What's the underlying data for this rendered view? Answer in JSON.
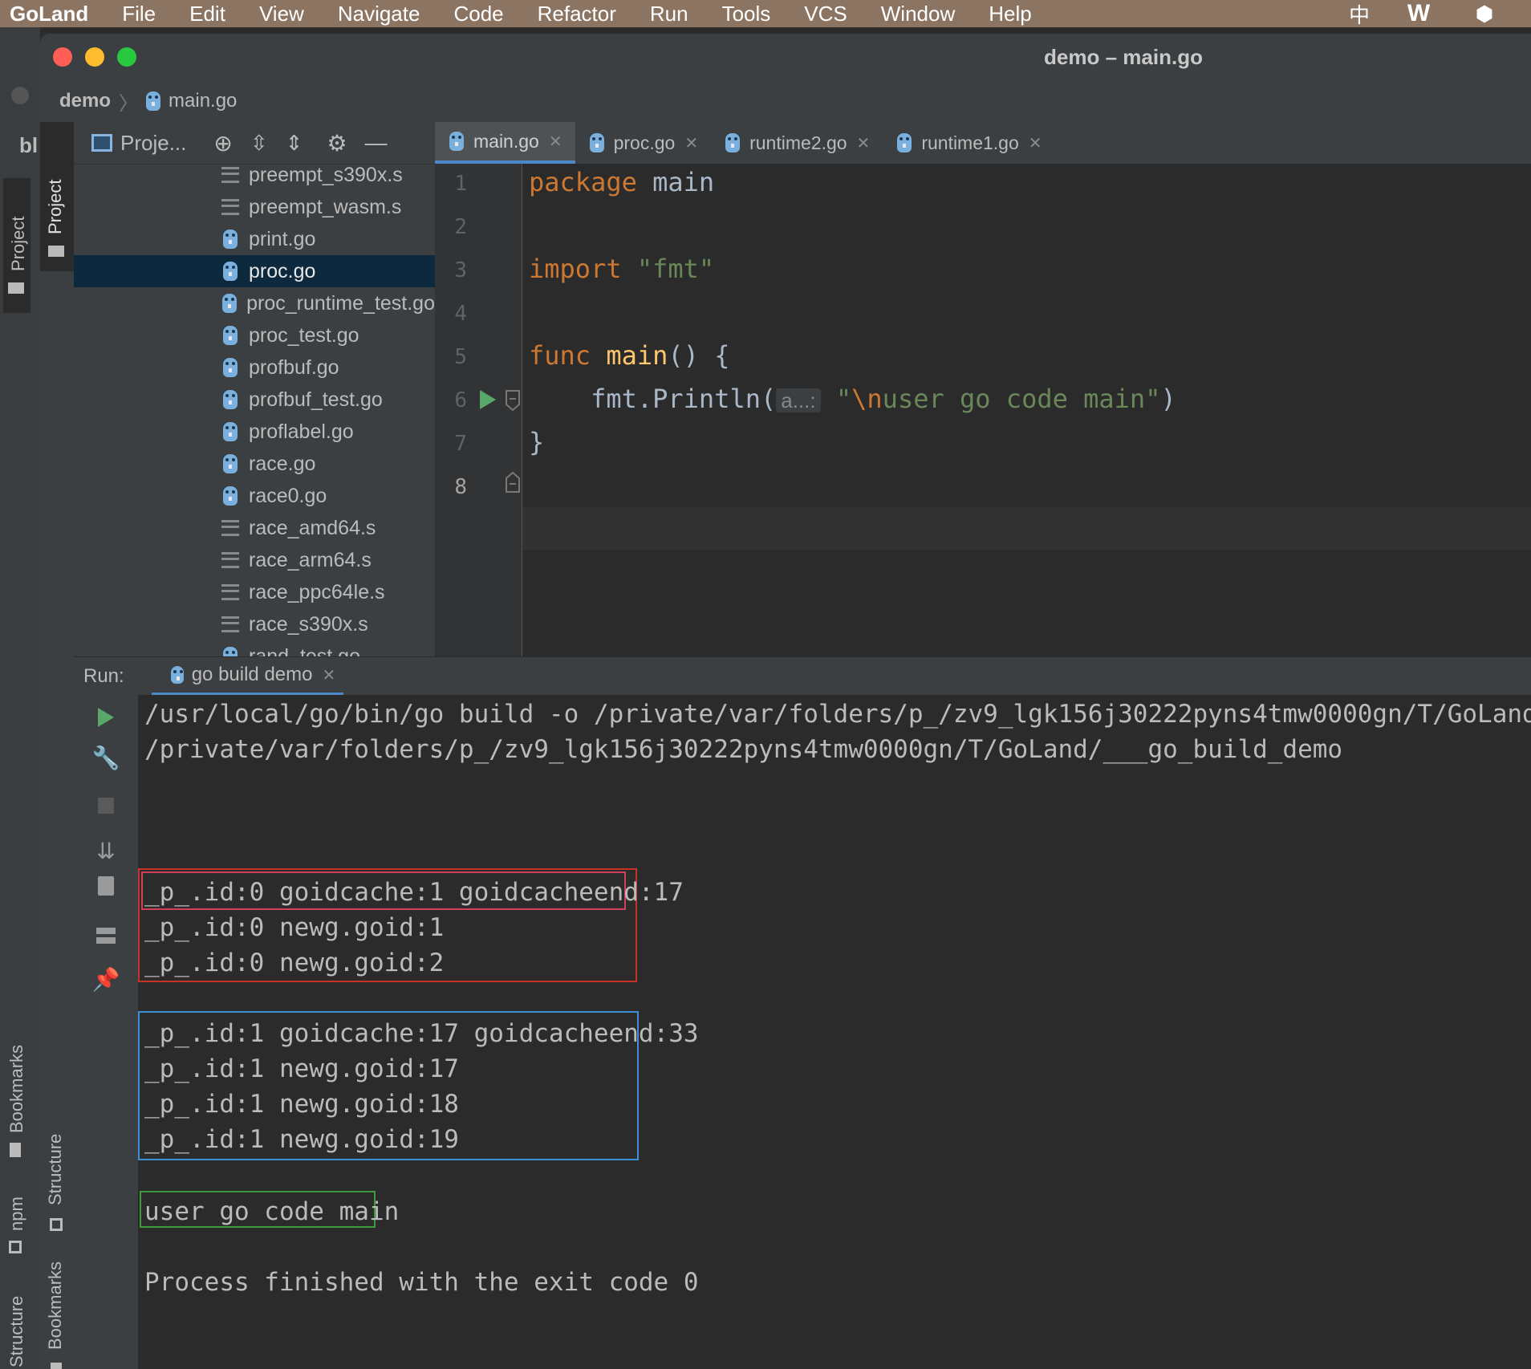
{
  "menubar": {
    "app": "GoLand",
    "items": [
      "File",
      "Edit",
      "View",
      "Navigate",
      "Code",
      "Refactor",
      "Run",
      "Tools",
      "VCS",
      "Window",
      "Help"
    ],
    "right_icons": [
      "input-method-icon",
      "w-app-icon",
      "hexagon-app-icon"
    ],
    "ime_glyph": "中",
    "w_glyph": "W",
    "hex_glyph": "⬢"
  },
  "bg_window": {
    "text": "bl",
    "tab": "Project"
  },
  "window": {
    "title": "demo – main.go",
    "breadcrumb": {
      "project": "demo",
      "file": "main.go"
    }
  },
  "tool_strip": {
    "project": "Project",
    "structure": "Structure",
    "bookmarks": "Bookmarks",
    "npm": "npm",
    "bookmarks_left": "Bookmarks",
    "structure_left": "Structure"
  },
  "project_panel": {
    "title": "Proje...",
    "icons": [
      "locate-icon",
      "expand-all-icon",
      "collapse-all-icon",
      "gear-icon",
      "minimize-icon"
    ],
    "files": [
      {
        "name": "preempt_s390x.s",
        "type": "asm"
      },
      {
        "name": "preempt_wasm.s",
        "type": "asm"
      },
      {
        "name": "print.go",
        "type": "go"
      },
      {
        "name": "proc.go",
        "type": "go",
        "selected": true
      },
      {
        "name": "proc_runtime_test.go",
        "type": "gotest"
      },
      {
        "name": "proc_test.go",
        "type": "gotest"
      },
      {
        "name": "profbuf.go",
        "type": "go"
      },
      {
        "name": "profbuf_test.go",
        "type": "gotest"
      },
      {
        "name": "proflabel.go",
        "type": "go"
      },
      {
        "name": "race.go",
        "type": "go"
      },
      {
        "name": "race0.go",
        "type": "go"
      },
      {
        "name": "race_amd64.s",
        "type": "asm"
      },
      {
        "name": "race_arm64.s",
        "type": "asm"
      },
      {
        "name": "race_ppc64le.s",
        "type": "asm"
      },
      {
        "name": "race_s390x.s",
        "type": "asm"
      },
      {
        "name": "rand_test.go",
        "type": "gotest"
      }
    ]
  },
  "editor": {
    "tabs": [
      {
        "label": "main.go",
        "active": true
      },
      {
        "label": "proc.go"
      },
      {
        "label": "runtime2.go"
      },
      {
        "label": "runtime1.go"
      }
    ],
    "line_numbers": [
      "1",
      "2",
      "3",
      "4",
      "5",
      "6",
      "7",
      "8"
    ],
    "code": {
      "l1_kw": "package",
      "l1_rest": " main",
      "l3_kw": "import",
      "l3_str": " \"fmt\"",
      "l5_kw": "func",
      "l5_fn": " main",
      "l5_rest": "() {",
      "l6_pre": "    fmt.Println(",
      "l6_hint": "a...:",
      "l6_q": "\"",
      "l6_esc": "\\n",
      "l6_str": "user go code main\"",
      "l6_end": ")",
      "l7": "}"
    }
  },
  "run": {
    "label": "Run:",
    "tab": "go build demo",
    "lines": {
      "cmd1": "/usr/local/go/bin/go build -o /private/var/folders/p_/zv9_lgk156j30222pyns4tmw0000gn/T/GoLand/___go_build_demo",
      "cmd2": "/private/var/folders/p_/zv9_lgk156j30222pyns4tmw0000gn/T/GoLand/___go_build_demo",
      "p0a": "_p_.id:0 goidcache:1 goidcacheend:17",
      "p0b": "_p_.id:0 newg.goid:1",
      "p0c": "_p_.id:0 newg.goid:2",
      "p1a": "_p_.id:1 goidcache:17 goidcacheend:33",
      "p1b": "_p_.id:1 newg.goid:17",
      "p1c": "_p_.id:1 newg.goid:18",
      "p1d": "_p_.id:1 newg.goid:19",
      "user": "user go code main",
      "exit": "Process finished with the exit code 0"
    },
    "box_colors": {
      "inner_red": "#d0405a",
      "outer_red": "#c83228",
      "blue": "#3c8fd6",
      "green": "#3f9a3f"
    }
  }
}
